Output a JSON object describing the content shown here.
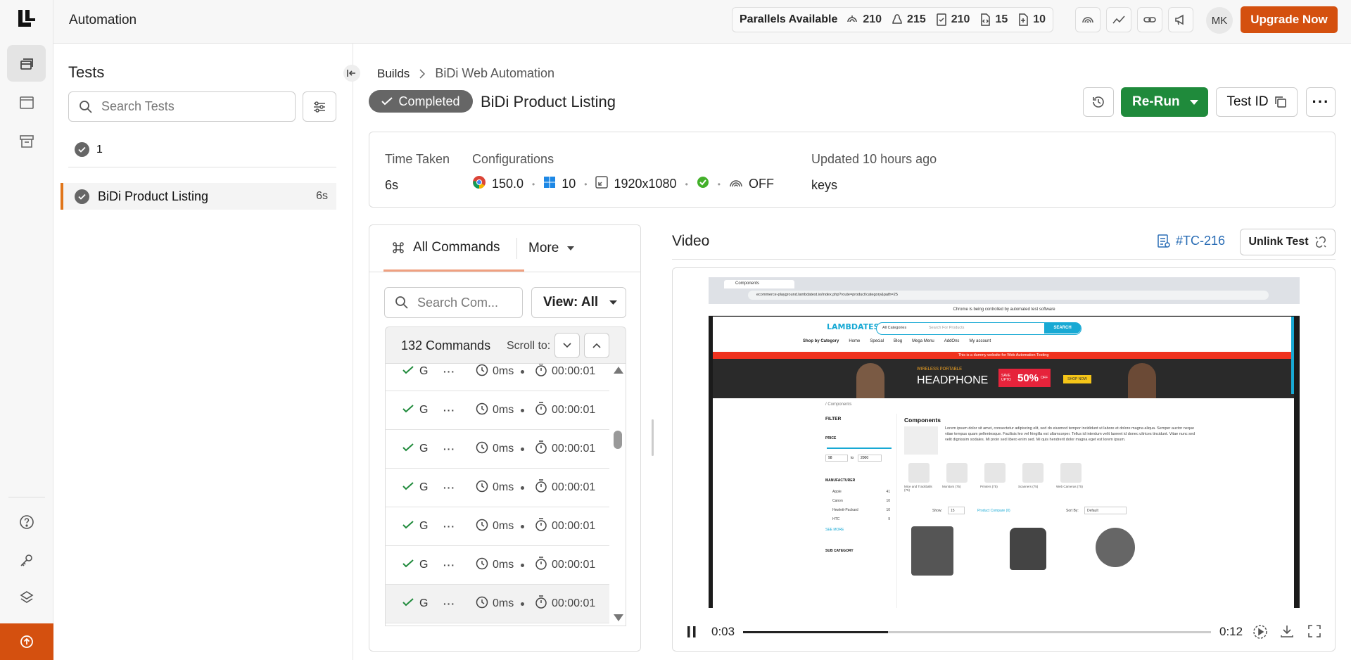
{
  "header": {
    "title": "Automation",
    "parallels_label": "Parallels Available",
    "parallels": [
      {
        "icon": "web-automation-icon",
        "value": "210"
      },
      {
        "icon": "linux-icon",
        "value": "215"
      },
      {
        "icon": "checklist-icon",
        "value": "210"
      },
      {
        "icon": "code-file-icon",
        "value": "15"
      },
      {
        "icon": "app-file-icon",
        "value": "10"
      }
    ],
    "avatar": "MK",
    "upgrade_label": "Upgrade Now"
  },
  "tests": {
    "title": "Tests",
    "search_placeholder": "Search Tests",
    "status_count": "1",
    "items": [
      {
        "name": "BiDi Product Listing",
        "duration": "6s"
      }
    ]
  },
  "breadcrumb": {
    "builds": "Builds",
    "current": "BiDi Web Automation"
  },
  "test": {
    "status": "Completed",
    "title": "BiDi Product Listing",
    "rerun_label": "Re-Run",
    "testid_label": "Test ID",
    "more_label": "···"
  },
  "info": {
    "time_label": "Time Taken",
    "time_value": "6s",
    "config_label": "Configurations",
    "browser_version": "150.0",
    "os_version": "10",
    "resolution": "1920x1080",
    "tunnel": "OFF",
    "updated_label": "Updated 10 hours ago",
    "updated_value": "keys"
  },
  "commands": {
    "tab_all": "All Commands",
    "tab_more": "More",
    "search_placeholder": "Search Com...",
    "view_label": "View: All",
    "count": "132 Commands",
    "scroll_label": "Scroll to:",
    "rows": [
      {
        "name": "G",
        "more": "···",
        "duration": "0ms",
        "time": "00:00:01"
      },
      {
        "name": "G",
        "more": "···",
        "duration": "0ms",
        "time": "00:00:01"
      },
      {
        "name": "G",
        "more": "···",
        "duration": "0ms",
        "time": "00:00:01"
      },
      {
        "name": "G",
        "more": "···",
        "duration": "0ms",
        "time": "00:00:01"
      },
      {
        "name": "G",
        "more": "···",
        "duration": "0ms",
        "time": "00:00:01"
      },
      {
        "name": "G",
        "more": "···",
        "duration": "0ms",
        "time": "00:00:01"
      },
      {
        "name": "G",
        "more": "···",
        "duration": "0ms",
        "time": "00:00:01"
      }
    ]
  },
  "video": {
    "title": "Video",
    "tc_link": "#TC-216",
    "unlink_label": "Unlink Test",
    "current_time": "0:03",
    "total_time": "0:12",
    "progress": 0.31,
    "frame": {
      "tab_title": "Components",
      "url": "ecommerce-playground.lambdatest.io/index.php?route=product/category&path=25",
      "infobar": "Chrome is being controlled by automated test software",
      "logo": "LAMBDATEST",
      "search_category": "All Categories",
      "search_placeholder": "Search For Products",
      "search_button": "SEARCH",
      "nav": [
        "Shop by Category",
        "Home",
        "Special",
        "Blog",
        "Mega Menu",
        "AddOns",
        "My account"
      ],
      "promo_strip": "This is a dummy website for Web Automation Testing",
      "banner_small": "WIRELESS PORTABLE",
      "banner_big": "HEADPHONE",
      "banner_save": "SAVE UPTO",
      "banner_pct": "50%",
      "banner_off": "OFF",
      "banner_cta": "SHOP NOW",
      "crumb": "/ Components",
      "filter_label": "FILTER",
      "price_label": "PRICE",
      "price_min": "98",
      "price_to": "to",
      "price_max": "2000",
      "manufacturer_label": "MANUFACTURER",
      "manufacturers": [
        {
          "name": "Apple",
          "count": "41"
        },
        {
          "name": "Canon",
          "count": "10"
        },
        {
          "name": "Hewlett-Packard",
          "count": "10"
        },
        {
          "name": "HTC",
          "count": "9"
        }
      ],
      "see_more": "SEE MORE",
      "subcategory_label": "SUB CATEGORY",
      "heading": "Components",
      "desc": "Lorem ipsum dolor sit amet, consectetur adipiscing elit, sed do eiusmod tempor incididunt ut labore et dolore magna aliqua. Semper auctor neque vitae tempus quam pellentesque. Facilisis leo vel fringilla est ullamcorper. Tellus id interdum velit laoreet id donec ultrices tincidunt. Vitae nunc sed velit dignissim sodales. Mi proin sed libero enim sed. Mi quis hendrerit dolor magna eget est lorem ipsum.",
      "categories": [
        "Mice and Trackballs (75)",
        "Monitors (75)",
        "Printers (75)",
        "Scanners (75)",
        "Web Cameras (75)"
      ],
      "show_label": "Show:",
      "show_value": "15",
      "compare": "Product Compare (0)",
      "sort_label": "Sort By:",
      "sort_value": "Default"
    }
  },
  "colors": {
    "accent_orange": "#d4500f",
    "rerun_green": "#1f8a3b",
    "link_blue": "#2a6db5"
  }
}
